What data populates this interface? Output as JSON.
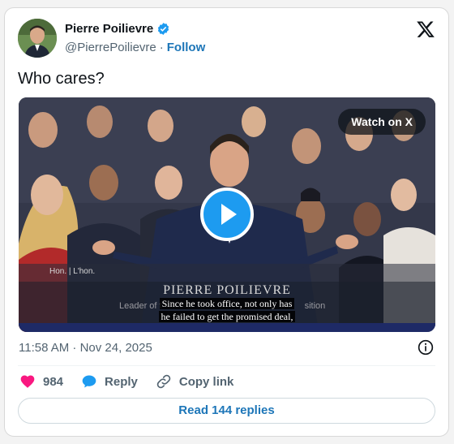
{
  "tweet": {
    "author_name": "Pierre Poilievre",
    "handle": "@PierrePoilievre",
    "separator": "·",
    "follow_label": "Follow",
    "text": "Who cares?",
    "timestamp": "11:58 AM · Nov 24, 2025"
  },
  "media": {
    "watch_label": "Watch on X",
    "hon_tag": "Hon.  |  L'hon.",
    "lower_third_name": "PIERRE POILIEVRE",
    "lower_third_sub": "Leader of t",
    "lower_third_sub_end": "sition",
    "caption_line1": "Since he took office, not only has",
    "caption_line2": "he failed to get the promised deal,"
  },
  "actions": {
    "like_count": "984",
    "reply_label": "Reply",
    "copy_link_label": "Copy link"
  },
  "replies_button": "Read 144 replies",
  "colors": {
    "link_blue": "#1d76b8",
    "verified_blue": "#1d9bf0",
    "like_pink": "#f91880",
    "text_gray": "#536471"
  }
}
